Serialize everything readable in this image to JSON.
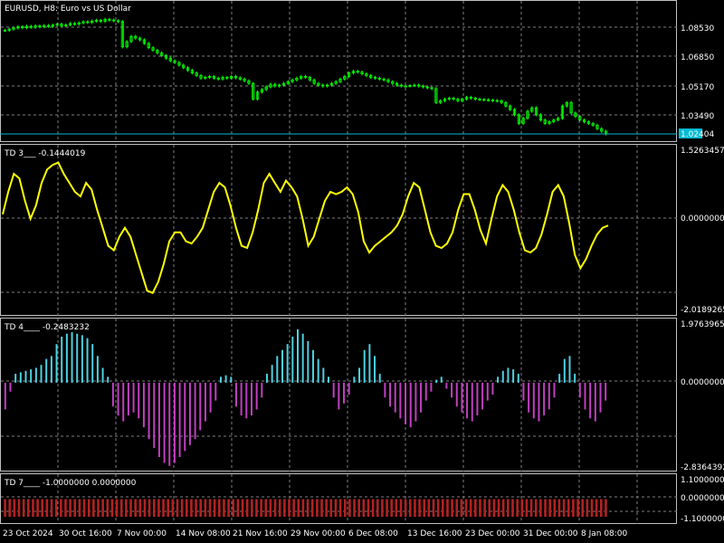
{
  "header": {
    "title": "EURUSD, H8:  Euro vs US Dollar"
  },
  "colors": {
    "background": "#000000",
    "grid": "#808080",
    "frame": "#c0c0c0",
    "bar_up": "#00ff00",
    "bid_line": "#00bcd4",
    "td3_line": "#ffff00",
    "td4_positive": "#4dd0e1",
    "td4_negative": "#c040c0",
    "td7_bars": "#b22222",
    "text": "#ffffff"
  },
  "chart_data": [
    {
      "id": "price",
      "type": "candlestick",
      "title": "EURUSD, H8:  Euro vs US Dollar",
      "y_ticks": [
        "1.08530",
        "1.06850",
        "1.05170",
        "1.03490"
      ],
      "current_price": "1.02404",
      "approx_close_series": [
        1.0835,
        1.0842,
        1.0848,
        1.0855,
        1.085,
        1.0858,
        1.0852,
        1.086,
        1.0855,
        1.0862,
        1.0858,
        1.0865,
        1.087,
        1.086,
        1.0866,
        1.0874,
        1.087,
        1.0878,
        1.0884,
        1.088,
        1.0888,
        1.0892,
        1.0886,
        1.0898,
        1.0894,
        1.089,
        1.0885,
        1.074,
        1.077,
        1.08,
        1.079,
        1.078,
        1.076,
        1.0735,
        1.072,
        1.0705,
        1.069,
        1.0675,
        1.066,
        1.065,
        1.0635,
        1.062,
        1.0605,
        1.059,
        1.0575,
        1.056,
        1.0565,
        1.057,
        1.056,
        1.0555,
        1.0565,
        1.056,
        1.057,
        1.0562,
        1.0555,
        1.0545,
        1.053,
        1.044,
        1.048,
        1.0495,
        1.051,
        1.0525,
        1.0515,
        1.052,
        1.053,
        1.054,
        1.055,
        1.056,
        1.057,
        1.0565,
        1.055,
        1.053,
        1.052,
        1.0515,
        1.052,
        1.053,
        1.054,
        1.0555,
        1.057,
        1.059,
        1.06,
        1.0595,
        1.0585,
        1.0575,
        1.0565,
        1.056,
        1.0555,
        1.055,
        1.054,
        1.053,
        1.052,
        1.0515,
        1.0515,
        1.0518,
        1.052,
        1.0515,
        1.051,
        1.0505,
        1.05,
        1.042,
        1.043,
        1.044,
        1.0445,
        1.044,
        1.043,
        1.044,
        1.045,
        1.0445,
        1.044,
        1.0438,
        1.0436,
        1.0434,
        1.0432,
        1.043,
        1.042,
        1.04,
        1.038,
        1.035,
        1.03,
        1.033,
        1.037,
        1.039,
        1.035,
        1.032,
        1.03,
        1.031,
        1.032,
        1.033,
        1.04,
        1.042,
        1.036,
        1.034,
        1.032,
        1.031,
        1.03,
        1.029,
        1.027,
        1.0255,
        1.024
      ],
      "candle_body_color": "#00ff00"
    },
    {
      "id": "td3",
      "type": "line",
      "title": "TD 3___ -0.1444019",
      "y_ticks": [
        "1.5263457",
        "0.0000000",
        "-2.0189265"
      ],
      "ylim": [
        -2.0189265,
        1.5263457
      ],
      "values": [
        0.1,
        0.6,
        1.0,
        0.9,
        0.4,
        0.0,
        0.3,
        0.8,
        1.1,
        1.2,
        1.25,
        1.0,
        0.8,
        0.6,
        0.5,
        0.8,
        0.65,
        0.2,
        -0.2,
        -0.6,
        -0.7,
        -0.4,
        -0.2,
        -0.4,
        -0.8,
        -1.2,
        -1.6,
        -1.65,
        -1.4,
        -1.0,
        -0.5,
        -0.3,
        -0.3,
        -0.5,
        -0.55,
        -0.4,
        -0.2,
        0.2,
        0.6,
        0.8,
        0.7,
        0.3,
        -0.2,
        -0.6,
        -0.65,
        -0.3,
        0.2,
        0.8,
        1.0,
        0.8,
        0.6,
        0.85,
        0.7,
        0.5,
        0.0,
        -0.6,
        -0.4,
        0.0,
        0.4,
        0.6,
        0.55,
        0.6,
        0.7,
        0.55,
        0.15,
        -0.5,
        -0.75,
        -0.6,
        -0.5,
        -0.4,
        -0.3,
        -0.15,
        0.1,
        0.5,
        0.8,
        0.7,
        0.2,
        -0.3,
        -0.6,
        -0.65,
        -0.55,
        -0.3,
        0.2,
        0.55,
        0.55,
        0.2,
        -0.25,
        -0.55,
        0.0,
        0.5,
        0.75,
        0.6,
        0.2,
        -0.3,
        -0.7,
        -0.75,
        -0.65,
        -0.35,
        0.1,
        0.6,
        0.75,
        0.5,
        -0.1,
        -0.8,
        -1.1,
        -0.9,
        -0.6,
        -0.35,
        -0.2,
        -0.15
      ]
    },
    {
      "id": "td4",
      "type": "histogram",
      "title": "TD 4____ -0.2483232",
      "y_ticks": [
        "1.9763965",
        "0.0000000",
        "-2.8364392"
      ],
      "ylim": [
        -2.8364392,
        1.9763965
      ],
      "values": [
        -0.9,
        -0.3,
        0.3,
        0.35,
        0.4,
        0.45,
        0.5,
        0.6,
        0.8,
        0.9,
        1.3,
        1.55,
        1.65,
        1.7,
        1.65,
        1.6,
        1.5,
        1.3,
        0.9,
        0.5,
        0.2,
        -0.8,
        -1.1,
        -1.3,
        -1.1,
        -1.0,
        -1.2,
        -1.5,
        -1.9,
        -2.2,
        -2.5,
        -2.7,
        -2.8,
        -2.7,
        -2.5,
        -2.3,
        -2.1,
        -1.9,
        -1.6,
        -1.3,
        -1.0,
        -0.6,
        0.2,
        0.25,
        0.2,
        -0.8,
        -1.1,
        -1.2,
        -1.1,
        -0.9,
        -0.5,
        0.3,
        0.6,
        0.9,
        1.1,
        1.3,
        1.55,
        1.8,
        1.65,
        1.4,
        1.1,
        0.8,
        0.5,
        0.2,
        -0.5,
        -0.9,
        -0.7,
        -0.4,
        0.2,
        0.5,
        1.1,
        1.3,
        0.9,
        0.3,
        -0.5,
        -0.8,
        -1.0,
        -1.2,
        -1.4,
        -1.5,
        -1.3,
        -1.0,
        -0.6,
        -0.3,
        0.1,
        0.2,
        -0.2,
        -0.5,
        -0.8,
        -1.0,
        -1.2,
        -1.3,
        -1.1,
        -0.9,
        -0.6,
        -0.4,
        0.2,
        0.4,
        0.5,
        0.45,
        0.3,
        -0.6,
        -1.0,
        -1.2,
        -1.3,
        -1.1,
        -0.9,
        -0.5,
        0.3,
        0.8,
        0.9,
        0.3,
        -0.5,
        -0.9,
        -1.2,
        -1.3,
        -1.0,
        -0.6
      ]
    },
    {
      "id": "td7",
      "type": "histogram",
      "title": "TD 7____ -1.0000000 0.0000000",
      "y_ticks": [
        "1.1000000",
        "0.0000000",
        "-1.1000000"
      ],
      "ylim": [
        -1.1,
        1.1
      ],
      "constant_value": -1.0,
      "bar_count": 130
    }
  ],
  "x_axis": {
    "labels": [
      "23 Oct 2024",
      "30 Oct 16:00",
      "7 Nov 00:00",
      "14 Nov 08:00",
      "21 Nov 16:00",
      "29 Nov 00:00",
      "6 Dec 08:00",
      "13 Dec 16:00",
      "23 Dec 00:00",
      "31 Dec 00:00",
      "8 Jan 08:00"
    ]
  }
}
